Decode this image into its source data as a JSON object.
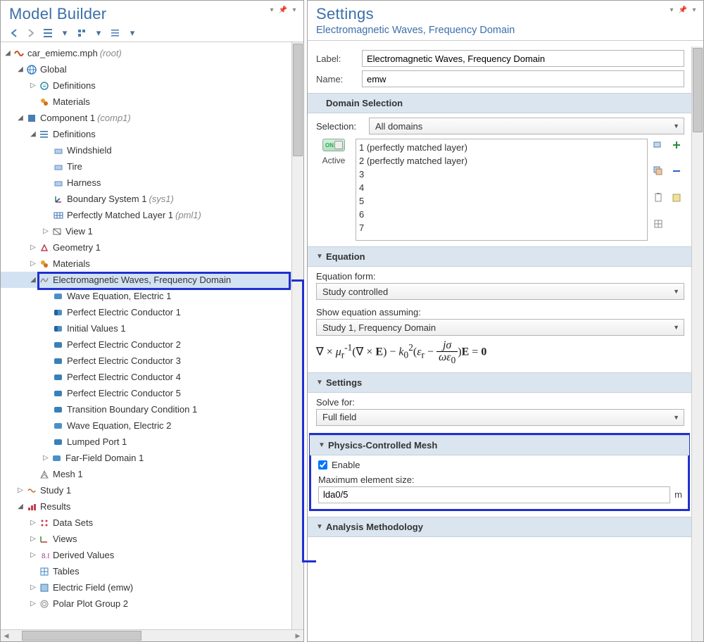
{
  "left_panel": {
    "title": "Model Builder",
    "root": {
      "label": "car_emiemc.mph",
      "suffix": "(root)"
    },
    "nodes": {
      "global": "Global",
      "defs_global": "Definitions",
      "materials": "Materials",
      "comp1": "Component 1",
      "comp1_suffix": "(comp1)",
      "defs_comp": "Definitions",
      "windshield": "Windshield",
      "tire": "Tire",
      "harness": "Harness",
      "bsys": "Boundary System 1",
      "bsys_suffix": "(sys1)",
      "pml": "Perfectly Matched Layer 1",
      "pml_suffix": "(pml1)",
      "view1": "View 1",
      "geom": "Geometry 1",
      "materials2": "Materials",
      "emw": "Electromagnetic Waves, Frequency Domain",
      "wave_eq1": "Wave Equation, Electric 1",
      "pec1": "Perfect Electric Conductor 1",
      "iv1": "Initial Values 1",
      "pec2": "Perfect Electric Conductor 2",
      "pec3": "Perfect Electric Conductor 3",
      "pec4": "Perfect Electric Conductor 4",
      "pec5": "Perfect Electric Conductor 5",
      "tbc1": "Transition Boundary Condition 1",
      "wave_eq2": "Wave Equation, Electric 2",
      "lport1": "Lumped Port 1",
      "ffd1": "Far-Field Domain 1",
      "mesh1": "Mesh 1",
      "study1": "Study 1",
      "results": "Results",
      "datasets": "Data Sets",
      "views": "Views",
      "derived": "Derived Values",
      "tables": "Tables",
      "efield": "Electric Field (emw)",
      "polar": "Polar Plot Group 2"
    }
  },
  "right_panel": {
    "title": "Settings",
    "subtitle": "Electromagnetic Waves, Frequency Domain",
    "label_field": "Label:",
    "label_value": "Electromagnetic Waves, Frequency Domain",
    "name_field": "Name:",
    "name_value": "emw",
    "section_domain": "Domain Selection",
    "selection_field": "Selection:",
    "selection_value": "All domains",
    "active_label": "Active",
    "domains": [
      "1 (perfectly matched layer)",
      "2 (perfectly matched layer)",
      "3",
      "4",
      "5",
      "6",
      "7"
    ],
    "section_equation": "Equation",
    "eqform_label": "Equation form:",
    "eqform_value": "Study controlled",
    "show_eq_label": "Show equation assuming:",
    "show_eq_value": "Study 1, Frequency Domain",
    "section_settings": "Settings",
    "solve_label": "Solve for:",
    "solve_value": "Full field",
    "section_mesh": "Physics-Controlled Mesh",
    "enable_label": "Enable",
    "max_elem_label": "Maximum element size:",
    "max_elem_value": "lda0/5",
    "max_elem_unit": "m",
    "section_analysis": "Analysis Methodology"
  }
}
